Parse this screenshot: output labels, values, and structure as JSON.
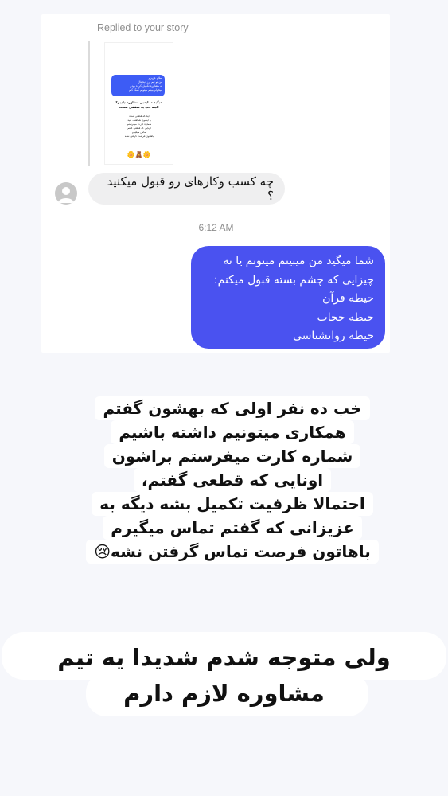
{
  "reply_header": "Replied to your story",
  "story_preview": {
    "bubble_text": "سلام عزیزم\nمن تو تیم ارز دیجیتال\nیه مشاوره تکمیل کرده بودم\nمیخوام ببینم میتونم کمک کنم",
    "title": "میگید ما ایمیل مشاوره دادیم؟\nالبته خب یه سقفی هست",
    "text": "اینا که قطعی شده\nبا ایشون هماهنگ کنید\nشماره کارت میفرستم\nاونایی که قطعی گفتم\nتماس میگیرم\nباهاتون فرصت گرفتن نشه",
    "emojis": "🌼🧸🌼"
  },
  "incoming_message": "چه کسب وکارهای رو قبول میکنید ؟",
  "timestamp": "6:12 AM",
  "outgoing_message": {
    "lines": [
      "شما میگید من میبینم میتونم یا نه",
      "چیزایی که چشم بسته قبول میکنم:",
      "حیطه قرآن",
      "حیطه حجاب",
      "حیطه روانشناسی"
    ]
  },
  "story_caption_1": {
    "lines": [
      "خب ده نفر اولی که بهشون گفتم",
      "همکاری میتونیم داشته باشیم",
      "شماره کارت میفرستم براشون",
      "اونایی که قطعی گفتم،",
      "احتمالا ظرفیت تکمیل بشه دیگه به",
      "عزیزانی که گفتم تماس میگیرم",
      "باهاتون فرصت تماس گرفتن نشه😢"
    ]
  },
  "story_caption_2": {
    "lines": [
      "ولی متوجه شدم شدیدا یه تیم",
      "مشاوره لازم دارم"
    ]
  },
  "colors": {
    "outgoing_bubble": "#4a52f0",
    "incoming_bubble": "#efeff0",
    "background": "#f6f7fb"
  }
}
